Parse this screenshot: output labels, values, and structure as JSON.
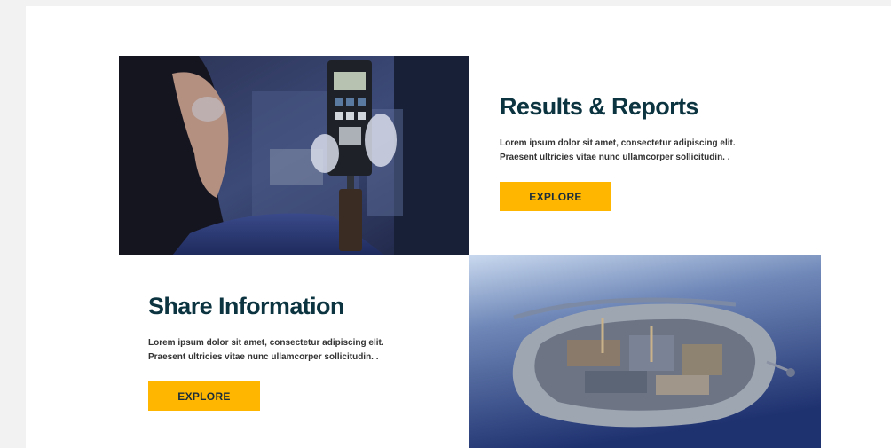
{
  "cards": [
    {
      "image_alt": "Lab technician holding a handheld measurement device",
      "title": "Results & Reports",
      "description_line1": "Lorem ipsum dolor sit amet, consectetur adipiscing elit.",
      "description_line2": "Praesent ultricies vitae nunc ullamcorper sollicitudin. .",
      "button_label": "EXPLORE"
    },
    {
      "image_alt": "Aerial view of an offshore artificial island",
      "title": "Share Information",
      "description_line1": "Lorem ipsum dolor sit amet, consectetur adipiscing elit.",
      "description_line2": "Praesent ultricies vitae nunc ullamcorper sollicitudin. .",
      "button_label": "EXPLORE"
    }
  ],
  "colors": {
    "accent": "#ffb600",
    "heading": "#0b3440",
    "background": "#f2f2f2"
  }
}
